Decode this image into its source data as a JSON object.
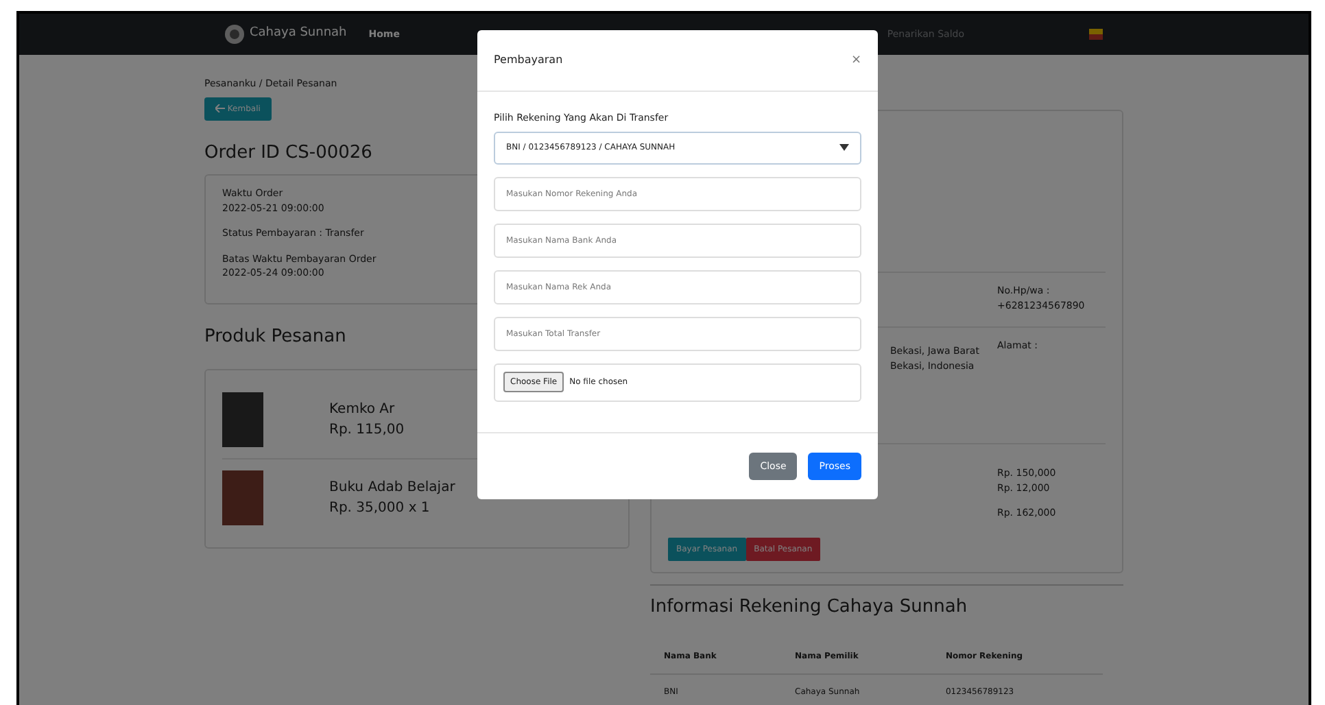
{
  "navbar": {
    "brand": "Cahaya Sunnah",
    "items": [
      {
        "label": "Home",
        "selected": true
      },
      {
        "label": "Penarikan Saldo",
        "selected": false
      }
    ]
  },
  "breadcrumb": "Pesananku / Detail Pesanan",
  "back_button": "Kembali",
  "order": {
    "title": "Order ID CS-00026",
    "details": [
      {
        "label": "Waktu Order",
        "value": "2022-05-21 09:00:00"
      },
      {
        "label": "Status Pembayaran : Transfer"
      },
      {
        "label": "Batas Waktu Pembayaran Order",
        "value": "2022-05-24 09:00:00"
      }
    ]
  },
  "products": {
    "title": "Produk Pesanan",
    "items": [
      {
        "name": "Kemko Ar",
        "price": "Rp. 115,00"
      },
      {
        "name": "Buku Adab Belajar",
        "price": "Rp. 35,000 x 1"
      }
    ]
  },
  "shipping": {
    "contact": [
      "No.Hp/wa :",
      "+6281234567890"
    ],
    "address_lines": [
      "Bekasi, Jawa Barat",
      "Bekasi, Indonesia"
    ],
    "address_label": "Alamat :",
    "totals": [
      "Rp. 150,000",
      "Rp. 12,000",
      "Rp. 162,000"
    ],
    "buttons": [
      {
        "label": "Bayar Pesanan",
        "kind": "pay"
      },
      {
        "label": "Batal Pesanan",
        "kind": "cancel"
      }
    ]
  },
  "bank_info": {
    "title": "Informasi Rekening Cahaya Sunnah",
    "columns": [
      "Nama Bank",
      "Nama Pemilik",
      "Nomor Rekening"
    ],
    "rows": [
      [
        "BNI",
        "Cahaya Sunnah",
        "0123456789123"
      ]
    ]
  },
  "modal": {
    "title": "Pembayaran",
    "close": "×",
    "select_label": "Pilih Rekening Yang Akan Di Transfer",
    "select_value": "BNI / 0123456789123 / CAHAYA SUNNAH",
    "fields": [
      {
        "placeholder": "Masukan Nomor Rekening Anda"
      },
      {
        "placeholder": "Masukan Nama Bank Anda"
      },
      {
        "placeholder": "Masukan Nama Rek Anda"
      },
      {
        "placeholder": "Masukan Total Transfer"
      }
    ],
    "file": {
      "button": "Choose File",
      "status": "No file chosen"
    },
    "buttons": [
      {
        "label": "Close",
        "kind": "secondary"
      },
      {
        "label": "Proses",
        "kind": "primary"
      }
    ]
  }
}
